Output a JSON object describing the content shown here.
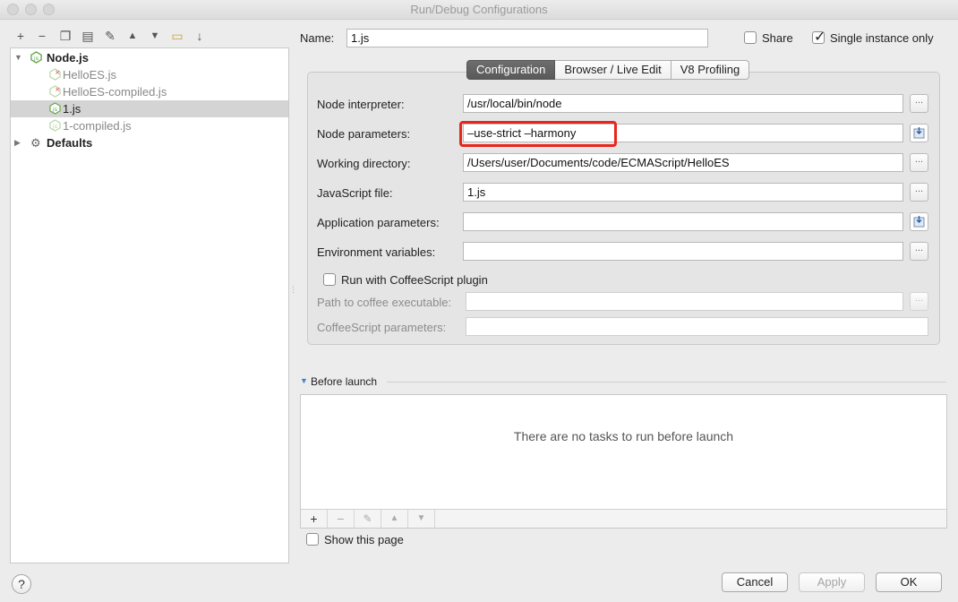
{
  "window": {
    "title": "Run/Debug Configurations"
  },
  "toolbar": {
    "icons": [
      "add-icon",
      "remove-icon",
      "copy-icon",
      "save-icon",
      "edit-defaults-icon",
      "move-up-icon",
      "move-down-icon",
      "folder-icon",
      "sort-icon"
    ],
    "glyphs": [
      "+",
      "−",
      "❐",
      "▤",
      "✎",
      "▲",
      "▼",
      "▭",
      "↓"
    ]
  },
  "tree": {
    "nodejs_label": "Node.js",
    "items": [
      {
        "label": "HelloES.js",
        "error": true
      },
      {
        "label": "HelloES-compiled.js",
        "error": true
      },
      {
        "label": "1.js",
        "selected": true
      },
      {
        "label": "1-compiled.js",
        "muted": true
      }
    ],
    "defaults_label": "Defaults"
  },
  "name": {
    "label": "Name:",
    "value": "1.js"
  },
  "share": {
    "label": "Share",
    "checked": false
  },
  "single_instance": {
    "label": "Single instance only",
    "checked": true
  },
  "tabs": [
    "Configuration",
    "Browser / Live Edit",
    "V8 Profiling"
  ],
  "form": {
    "node_interpreter": {
      "label": "Node interpreter:",
      "value": "/usr/local/bin/node"
    },
    "node_parameters": {
      "label": "Node parameters:",
      "value": "–use-strict –harmony"
    },
    "working_directory": {
      "label": "Working directory:",
      "value": "/Users/user/Documents/code/ECMAScript/HelloES"
    },
    "javascript_file": {
      "label": "JavaScript file:",
      "value": "1.js"
    },
    "application_parameters": {
      "label": "Application parameters:",
      "value": ""
    },
    "environment_variables": {
      "label": "Environment variables:",
      "value": ""
    },
    "coffeescript_plugin": {
      "label": "Run with CoffeeScript plugin",
      "checked": false
    },
    "coffee_executable": {
      "label": "Path to coffee executable:",
      "value": ""
    },
    "coffeescript_parameters": {
      "label": "CoffeeScript parameters:",
      "value": ""
    },
    "browse_glyph": "..."
  },
  "before_launch": {
    "label": "Before launch",
    "empty_text": "There are no tasks to run before launch",
    "tool_glyphs": [
      "+",
      "−",
      "✎",
      "▲",
      "▼"
    ]
  },
  "show_this_page": {
    "label": "Show this page",
    "checked": false
  },
  "buttons": {
    "help": "?",
    "cancel": "Cancel",
    "apply": "Apply",
    "ok": "OK"
  },
  "colors": {
    "highlight": "#e8261e",
    "active_tab": "#5e5e5e",
    "selected_row": "#d4d4d4"
  }
}
